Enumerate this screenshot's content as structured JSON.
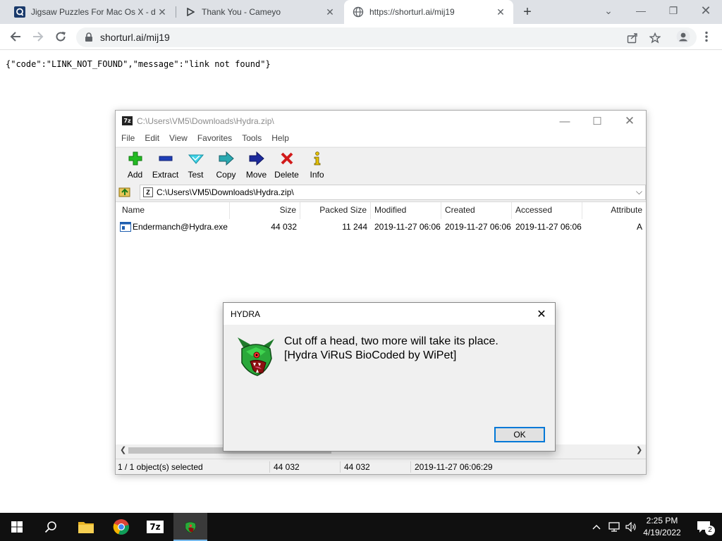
{
  "browser": {
    "tabs": [
      {
        "label": "Jigsaw Puzzles For Mac Os X - do"
      },
      {
        "label": "Thank You - Cameyo"
      },
      {
        "label": "https://shorturl.ai/mij19"
      }
    ],
    "address": "shorturl.ai/mij19"
  },
  "page": {
    "json_text": "{\"code\":\"LINK_NOT_FOUND\",\"message\":\"link not found\"}"
  },
  "zip": {
    "title": "C:\\Users\\VM5\\Downloads\\Hydra.zip\\",
    "app_icon_text": "7z",
    "menu": [
      "File",
      "Edit",
      "View",
      "Favorites",
      "Tools",
      "Help"
    ],
    "toolbar": [
      "Add",
      "Extract",
      "Test",
      "Copy",
      "Move",
      "Delete",
      "Info"
    ],
    "path": "C:\\Users\\VM5\\Downloads\\Hydra.zip\\",
    "columns": [
      "Name",
      "Size",
      "Packed Size",
      "Modified",
      "Created",
      "Accessed",
      "Attribute"
    ],
    "row": {
      "name": "Endermanch@Hydra.exe",
      "size": "44 032",
      "packed": "11 244",
      "modified": "2019-11-27 06:06",
      "created": "2019-11-27 06:06",
      "accessed": "2019-11-27 06:06",
      "attr": "A"
    },
    "status": {
      "selection": "1 / 1 object(s) selected",
      "size": "44 032",
      "packed": "44 032",
      "date": "2019-11-27 06:06:29"
    }
  },
  "dialog": {
    "title": "HYDRA",
    "line1": "Cut off a head, two more will take its place.",
    "line2": "[Hydra ViRuS BioCoded by WiPet]",
    "ok": "OK"
  },
  "taskbar": {
    "time": "2:25 PM",
    "date": "4/19/2022",
    "notification_count": "2",
    "sevenzip_icon_text": "7z"
  },
  "colors": {
    "accent": "#0078d7",
    "taskbar": "#101010",
    "tabstrip": "#dee1e6"
  }
}
